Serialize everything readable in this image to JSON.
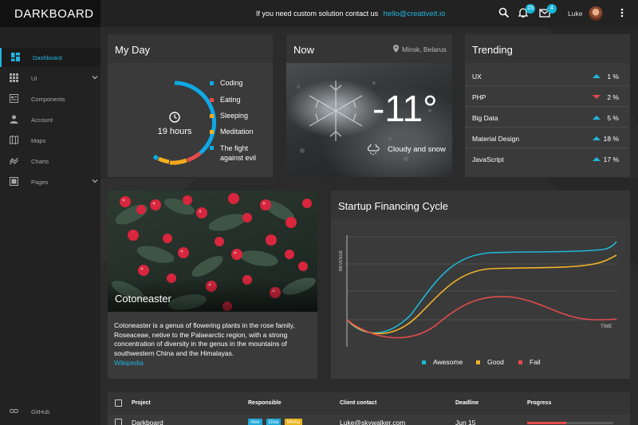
{
  "brand": "DARKBOARD",
  "topbar": {
    "contact_text": "If you need custom solution contact us",
    "contact_email": "hello@creativeit.io",
    "notifications_count": "23",
    "messages_count": "4",
    "user_name": "Luke"
  },
  "sidebar": {
    "items": [
      {
        "label": "Dashboard",
        "icon": "dashboard-icon"
      },
      {
        "label": "UI",
        "icon": "grid-icon"
      },
      {
        "label": "Components",
        "icon": "components-icon"
      },
      {
        "label": "Account",
        "icon": "account-icon"
      },
      {
        "label": "Maps",
        "icon": "map-icon"
      },
      {
        "label": "Charts",
        "icon": "charts-icon"
      },
      {
        "label": "Pages",
        "icon": "pages-icon"
      }
    ],
    "footer_label": "GitHub"
  },
  "my_day": {
    "title": "My Day",
    "center_label": "19 hours",
    "legend": [
      {
        "label": "Coding",
        "color": "#0fa9e6"
      },
      {
        "label": "Eating",
        "color": "#e84a4a"
      },
      {
        "label": "Sleeping",
        "color": "#f4a81c"
      },
      {
        "label": "Meditation",
        "color": "#f4b31c"
      },
      {
        "label": "The fight",
        "color": "#0fa9e6"
      }
    ],
    "legend_extra": "against evil"
  },
  "now": {
    "title": "Now",
    "location": "Minsk, Belarus",
    "temperature": "-11°",
    "condition": "Cloudy and snow"
  },
  "trending": {
    "title": "Trending",
    "rows": [
      {
        "name": "UX",
        "direction": "up",
        "pct": "1 %"
      },
      {
        "name": "PHP",
        "direction": "down",
        "pct": "2 %"
      },
      {
        "name": "Big Data",
        "direction": "up",
        "pct": "5 %"
      },
      {
        "name": "Material Design",
        "direction": "up",
        "pct": "18 %"
      },
      {
        "name": "JavaScript",
        "direction": "up",
        "pct": "17 %"
      }
    ]
  },
  "plant": {
    "title": "Cotoneaster",
    "description": "Cotoneaster is a genus of flowering plants in the rose family, Roseaceae, netive to the Palaearctic region, with a strong concentration of diversity in the genus in the mountains of southwestern China and the Himalayas.",
    "link": "Wikipedia"
  },
  "financing": {
    "title": "Startup Financing Cycle",
    "ylabel": "REVENUE",
    "xlabel": "TIME",
    "legend": [
      {
        "label": "Awesome",
        "color": "#1fb6d4"
      },
      {
        "label": "Good",
        "color": "#f0b429"
      },
      {
        "label": "Fail",
        "color": "#e24b4b"
      }
    ]
  },
  "table": {
    "headers": [
      "Project",
      "Responsible",
      "Client contact",
      "Deadline",
      "Progress"
    ],
    "rows": [
      {
        "project": "Darkboard",
        "tags": [
          "Alex",
          "Dina",
          "Misha"
        ],
        "contact": "Luke@skywalker.com",
        "deadline": "Jun 15",
        "progress": 0.45
      }
    ],
    "tag_colors": [
      "#1fa8d8",
      "#1fa8d8",
      "#e8b31c"
    ]
  }
}
